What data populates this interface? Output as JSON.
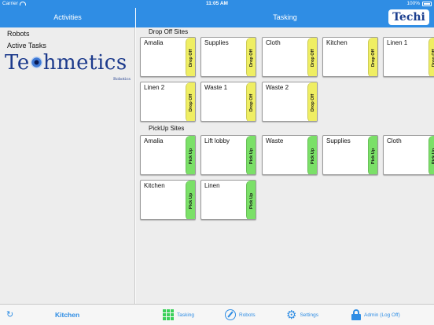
{
  "status_bar": {
    "carrier": "Carrier",
    "time": "11:05 AM",
    "battery": "100%"
  },
  "nav": {
    "left_title": "Activities",
    "right_title": "Tasking",
    "logo_text": "Techi"
  },
  "sidebar": {
    "items": [
      {
        "label": "Robots"
      },
      {
        "label": "Active Tasks"
      }
    ],
    "brand": {
      "text_a": "Te",
      "text_b": "hmetics",
      "sub": "Robotics"
    }
  },
  "drop_off": {
    "title": "Drop Off Sites",
    "tab_label": "Drop Off",
    "sites": [
      {
        "label": "Amalia"
      },
      {
        "label": "Supplies"
      },
      {
        "label": "Cloth"
      },
      {
        "label": "Kitchen"
      },
      {
        "label": "Linen 1"
      },
      {
        "label": "Linen 2"
      },
      {
        "label": "Waste 1"
      },
      {
        "label": "Waste 2"
      }
    ]
  },
  "pick_up": {
    "title": "PickUp Sites",
    "tab_label": "Pick Up",
    "sites": [
      {
        "label": "Amalia"
      },
      {
        "label": "Lift lobby"
      },
      {
        "label": "Waste"
      },
      {
        "label": "Supplies"
      },
      {
        "label": "Cloth"
      },
      {
        "label": "Kitchen"
      },
      {
        "label": "Linen"
      }
    ]
  },
  "bottom_bar": {
    "location": "Kitchen",
    "tabs": [
      {
        "label": "Tasking",
        "icon": "grid-icon"
      },
      {
        "label": "Robots",
        "icon": "compass-icon"
      },
      {
        "label": "Settings",
        "icon": "gears-icon"
      },
      {
        "label": "Admin (Log Off)",
        "icon": "lock-icon"
      }
    ]
  },
  "colors": {
    "accent": "#2f8de4",
    "drop_tab": "#efee63",
    "pick_tab": "#7be068",
    "grid_icon": "#3bd15a",
    "brand": "#1c3a8c"
  }
}
